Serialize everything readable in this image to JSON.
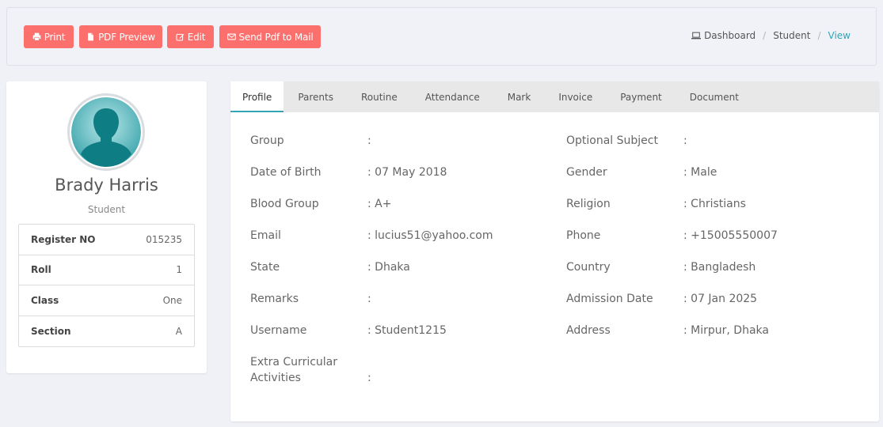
{
  "actions": {
    "print": "Print",
    "pdf_preview": "PDF Preview",
    "edit": "Edit",
    "send_mail": "Send Pdf to Mail"
  },
  "breadcrumb": {
    "dashboard": "Dashboard",
    "student": "Student",
    "current": "View"
  },
  "profile": {
    "name": "Brady Harris",
    "role": "Student",
    "info": [
      {
        "label": "Register NO",
        "value": "015235"
      },
      {
        "label": "Roll",
        "value": "1"
      },
      {
        "label": "Class",
        "value": "One"
      },
      {
        "label": "Section",
        "value": "A"
      }
    ]
  },
  "tabs": [
    "Profile",
    "Parents",
    "Routine",
    "Attendance",
    "Mark",
    "Invoice",
    "Payment",
    "Document"
  ],
  "active_tab": "Profile",
  "details": {
    "left": [
      {
        "label": "Group",
        "value": ":"
      },
      {
        "label": "Date of Birth",
        "value": ": 07 May 2018"
      },
      {
        "label": "Blood Group",
        "value": ": A+"
      },
      {
        "label": "Email",
        "value": ": lucius51@yahoo.com"
      },
      {
        "label": "State",
        "value": ": Dhaka"
      },
      {
        "label": "Remarks",
        "value": ":"
      },
      {
        "label": "Username",
        "value": ": Student1215"
      },
      {
        "label": "Extra Curricular Activities",
        "value": ":"
      }
    ],
    "right": [
      {
        "label": "Optional Subject",
        "value": ":"
      },
      {
        "label": "Gender",
        "value": ": Male"
      },
      {
        "label": "Religion",
        "value": ": Christians"
      },
      {
        "label": "Phone",
        "value": ": +15005550007"
      },
      {
        "label": "Country",
        "value": ": Bangladesh"
      },
      {
        "label": "Admission Date",
        "value": ": 07 Jan 2025"
      },
      {
        "label": "Address",
        "value": ": Mirpur, Dhaka"
      }
    ]
  },
  "colors": {
    "action_button": "#fb6f6c",
    "accent": "#35a4b4",
    "page_background": "#eff1f6"
  },
  "icons": {
    "print": "print-icon",
    "pdf": "file-icon",
    "edit": "edit-icon",
    "mail": "envelope-icon",
    "dashboard": "laptop-icon",
    "avatar": "user-silhouette-icon"
  }
}
